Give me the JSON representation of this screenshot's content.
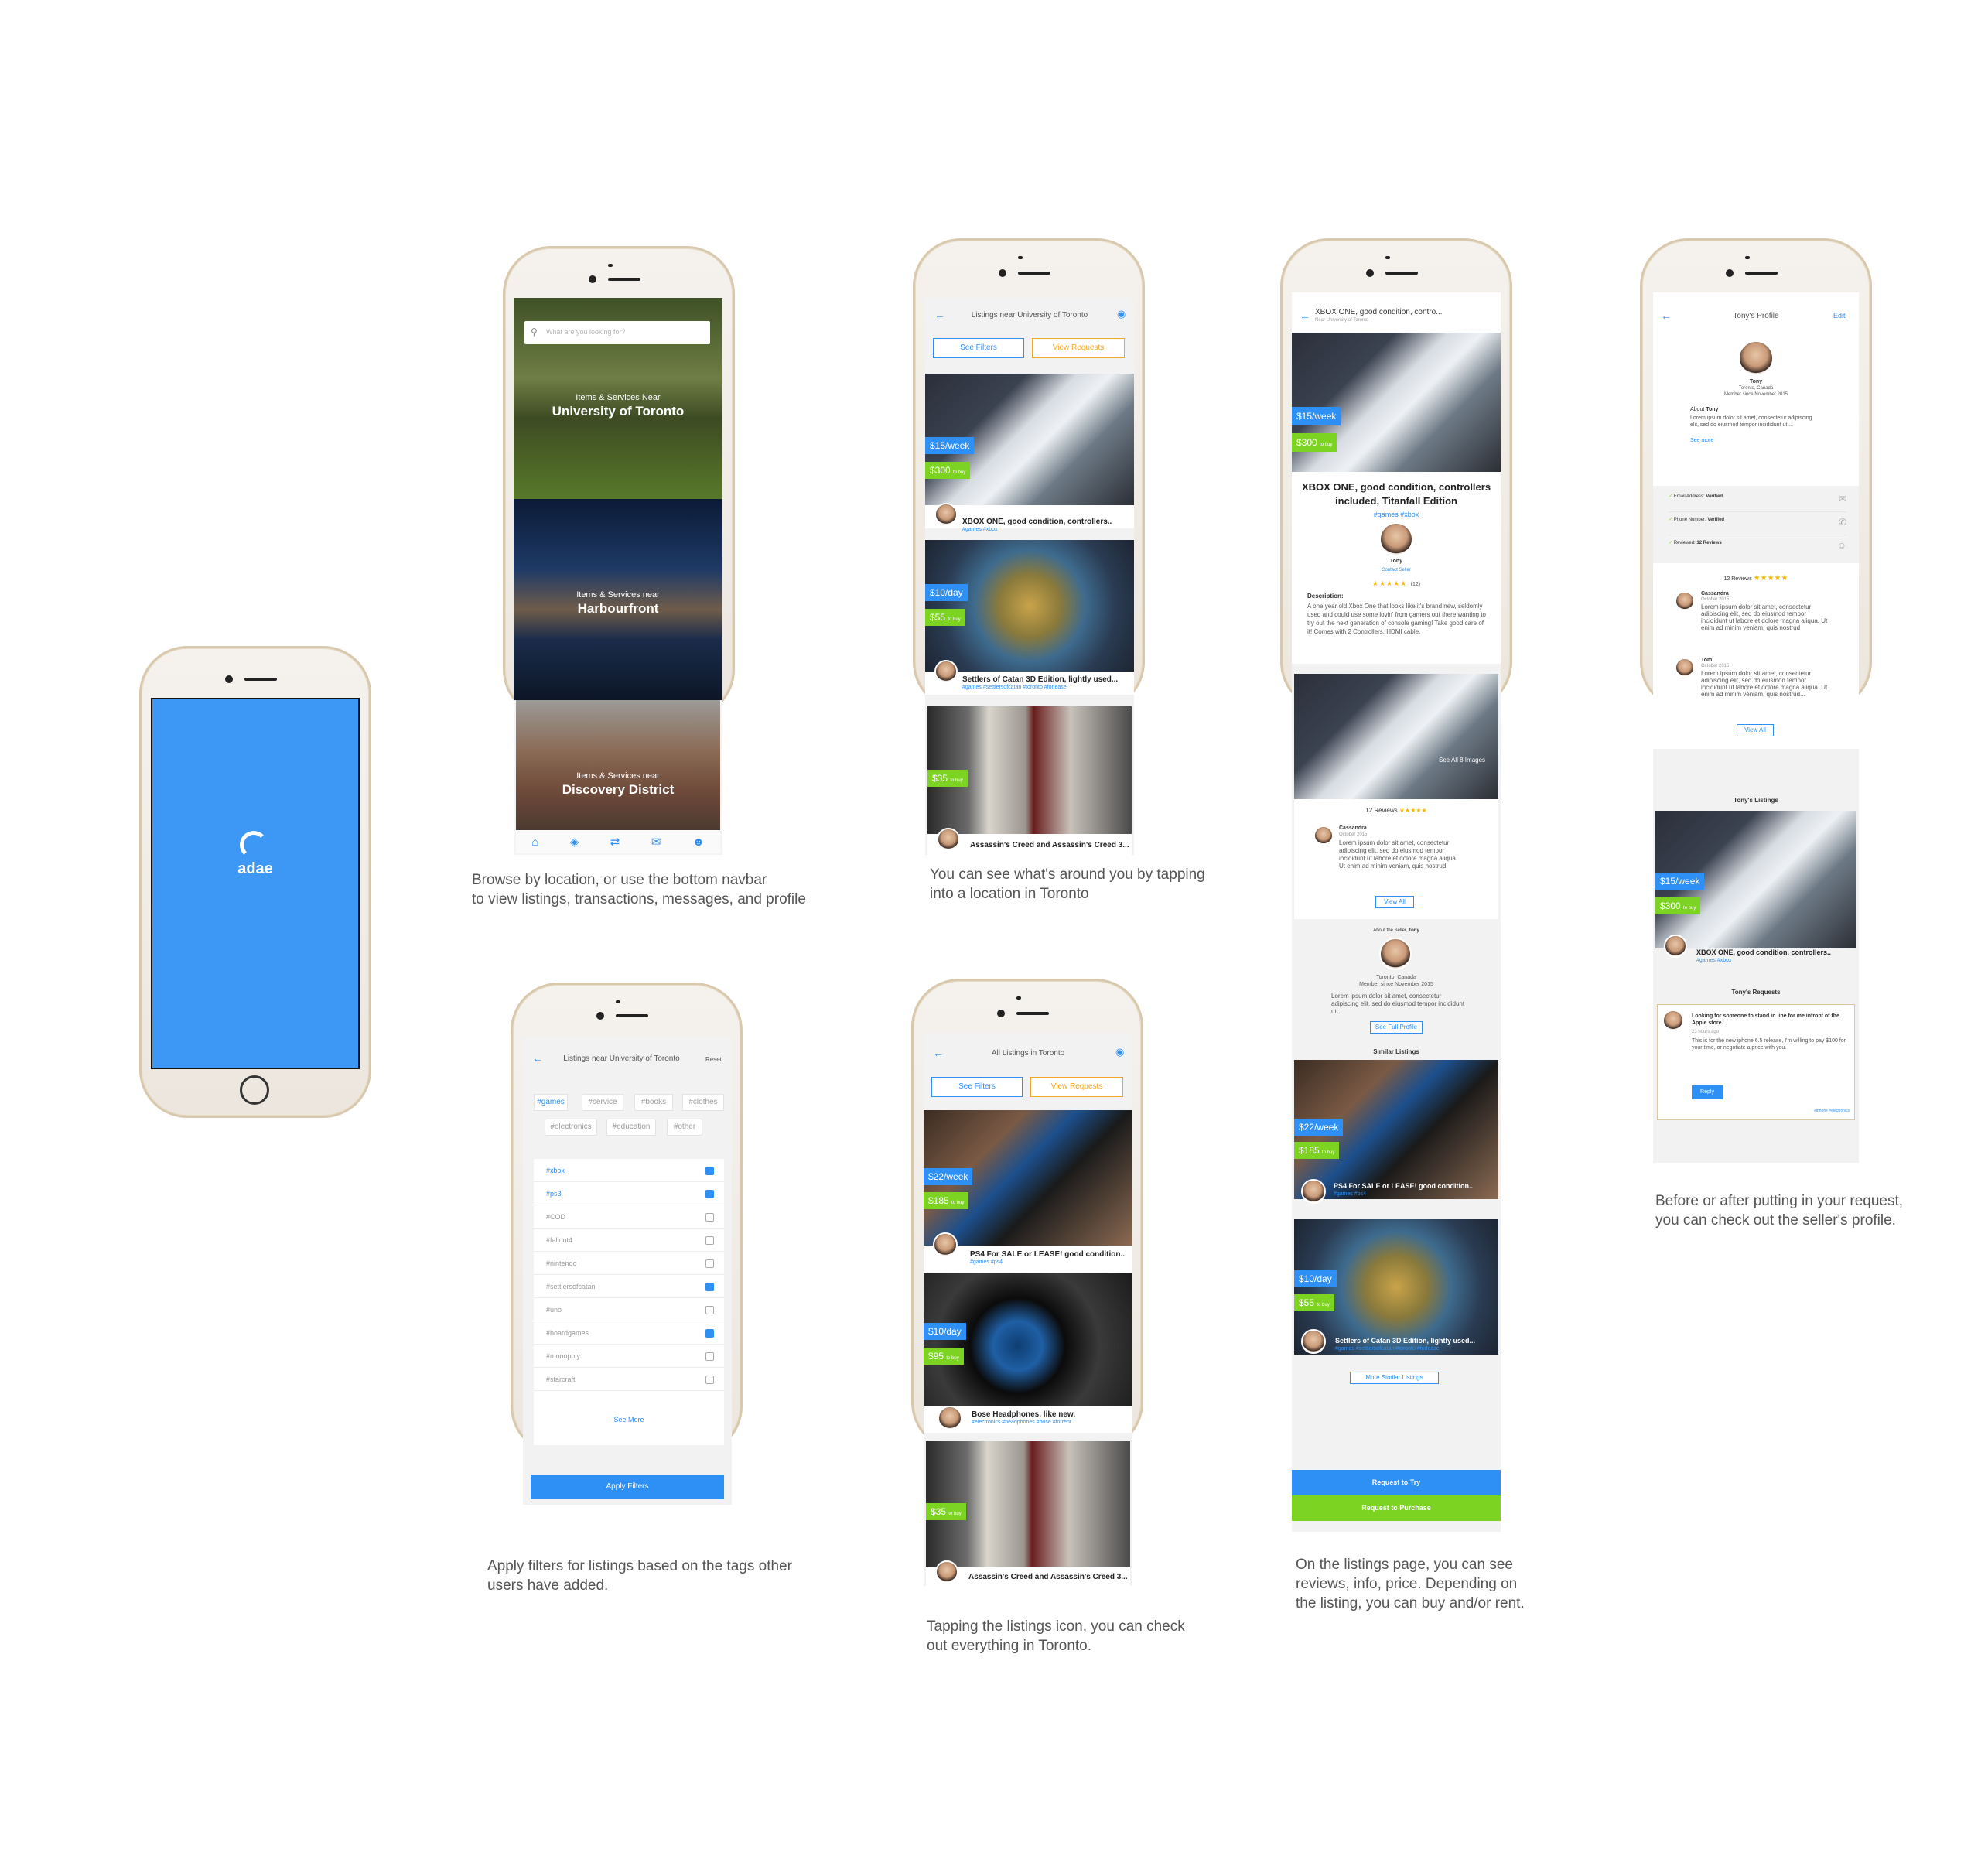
{
  "splash": {
    "logo": "adae"
  },
  "browse": {
    "search_placeholder": "What are you looking for?",
    "locations": [
      {
        "prefix": "Items & Services Near",
        "name": "University of Toronto"
      },
      {
        "prefix": "Items & Services near",
        "name": "Harbourfront"
      },
      {
        "prefix": "Items & Services near",
        "name": "Discovery District"
      }
    ],
    "nav_icons": [
      "home-icon",
      "tag-icon",
      "handshake-icon",
      "mail-icon",
      "profile-icon"
    ],
    "caption": [
      "Browse by location, or use the bottom navbar",
      "to view listings, transactions, messages, and profile"
    ]
  },
  "listings_uoft": {
    "header": "Listings near University of Toronto",
    "see_filters": "See Filters",
    "view_requests": "View Requests",
    "items": [
      {
        "rent": "$15/week",
        "buy": "$300",
        "buy_suffix": "to buy",
        "title": "XBOX ONE, good condition, controllers..",
        "tags": "#games #xbox"
      },
      {
        "rent": "$10/day",
        "buy": "$55",
        "buy_suffix": "to buy",
        "title": "Settlers of Catan 3D Edition, lightly used...",
        "tags": "#games #settlersofcatan #toronto #forlease"
      },
      {
        "buy": "$35",
        "buy_suffix": "to buy",
        "title": "Assassin's Creed and Assassin's Creed 3..."
      }
    ],
    "caption": [
      "You can see what's around you by tapping",
      "into a location in Toronto"
    ]
  },
  "filters": {
    "header": "Listings near University of Toronto",
    "reset": "Reset",
    "tags": [
      "#games",
      "#service",
      "#books",
      "#clothes",
      "#electronics",
      "#education",
      "#other"
    ],
    "options": [
      {
        "label": "#xbox",
        "checked": true
      },
      {
        "label": "#ps3",
        "checked": true
      },
      {
        "label": "#COD",
        "checked": false
      },
      {
        "label": "#fallout4",
        "checked": false
      },
      {
        "label": "#nintendo",
        "checked": false
      },
      {
        "label": "#settlersofcatan",
        "checked": true
      },
      {
        "label": "#uno",
        "checked": false
      },
      {
        "label": "#boardgames",
        "checked": true
      },
      {
        "label": "#monopoly",
        "checked": false
      },
      {
        "label": "#starcraft",
        "checked": false
      }
    ],
    "see_more": "See More",
    "apply": "Apply Filters",
    "caption": [
      "Apply filters for listings based on the tags other",
      "users have added."
    ]
  },
  "all_toronto": {
    "header": "All Listings in Toronto",
    "see_filters": "See Filters",
    "view_requests": "View Requests",
    "items": [
      {
        "rent": "$22/week",
        "buy": "$185",
        "buy_suffix": "to buy",
        "title": "PS4 For SALE or LEASE! good condition..",
        "tags": "#games #ps4"
      },
      {
        "rent": "$10/day",
        "buy": "$95",
        "buy_suffix": "to buy",
        "title": "Bose Headphones, like new.",
        "tags": "#electronics #headphones #bose #forrent"
      },
      {
        "buy": "$35",
        "buy_suffix": "to buy",
        "title": "Assassin's Creed and Assassin's Creed 3..."
      }
    ],
    "caption": [
      "Tapping  the listings icon, you can check",
      "out everything in Toronto."
    ]
  },
  "detail": {
    "header": "XBOX ONE, good condition, contro...",
    "subheader": "Near University of Toronto",
    "rent": "$15/week",
    "buy": "$300",
    "buy_suffix": "to buy",
    "title": [
      "XBOX ONE, good condition, controllers",
      "included, Titanfall Edition"
    ],
    "tags": "#games #xbox",
    "seller": "Tony",
    "contact": "Contact Seller",
    "rating_count": "(12)",
    "desc_label": "Description:",
    "desc": "A one year old Xbox One that looks like it's brand new, seldomly used and could use some lovin' from gamers out there wanting to try out the next generation of console gaming! Take good care of it! Comes with 2 Controllers, HDMI cable.",
    "see_all_images": "See All 8 Images",
    "reviews_title": "12 Reviews",
    "reviewer": "Cassandra",
    "review_date": "October 2015",
    "review_text": "Lorem ipsum dolor sit amet, consectetur adipiscing elit, sed do eiusmod tempor incididunt ut labore et dolore magna aliqua. Ut enim ad minim veniam, quis nostrud",
    "view_all": "View All",
    "about_label": "About the Seller,",
    "about_name": "Tony",
    "seller_loc": "Toronto, Canada",
    "seller_since": "Member since November 2015",
    "seller_text": "Lorem ipsum dolor sit amet, consectetur adipiscing elit, sed do eiusmod tempor incididunt ut ...",
    "full_profile": "See Full Profile",
    "similar": "Similar Listings",
    "sim_items": [
      {
        "rent": "$22/week",
        "buy": "$185",
        "buy_suffix": "to buy",
        "title": "PS4 For SALE or LEASE! good condition..",
        "tags": "#games #ps4"
      },
      {
        "rent": "$10/day",
        "buy": "$55",
        "buy_suffix": "to buy",
        "title": "Settlers of Catan 3D Edition, lightly used...",
        "tags": "#games #settlersofcatan #toronto #forlease"
      }
    ],
    "more_similar": "More Similar Listings",
    "request_try": "Request to Try",
    "request_purchase": "Request to Purchase",
    "caption": [
      "On the listings page, you can see",
      "reviews, info, price. Depending on",
      "the listing, you can buy and/or rent."
    ]
  },
  "profile": {
    "header": "Tony's Profile",
    "edit": "Edit",
    "name": "Tony",
    "loc": "Toronto, Canada",
    "since": "Member since November 2015",
    "about_label": "About",
    "about_name": "Tony",
    "about_text": "Lorem ipsum dolor sit amet, consectetur adipiscing elit, sed do eiusmod tempor incididunt ut ...",
    "see_more": "See more",
    "verifs": [
      {
        "label": "Email Address:",
        "value": "Verified"
      },
      {
        "label": "Phone Number:",
        "value": "Verified"
      },
      {
        "label": "Reviewed:",
        "value": "12 Reviews"
      }
    ],
    "reviews_title": "12 Reviews",
    "reviews": [
      {
        "name": "Cassandra",
        "date": "October 2015",
        "text": "Lorem ipsum dolor sit amet, consectetur adipiscing elit, sed do eiusmod tempor incididunt ut labore et dolore magna aliqua. Ut enim ad minim veniam, quis nostrud"
      },
      {
        "name": "Tom",
        "date": "October 2015",
        "text": "Lorem ipsum dolor sit amet, consectetur adipiscing elit, sed do eiusmod tempor incididunt ut labore et dolore magna aliqua. Ut enim ad minim veniam, quis nostrud..."
      }
    ],
    "view_all": "View All",
    "listings_title": "Tony's Listings",
    "listing": {
      "rent": "$15/week",
      "buy": "$300",
      "buy_suffix": "to buy",
      "title": "XBOX ONE, good condition, controllers..",
      "tags": "#games #xbox"
    },
    "requests_title": "Tony's Requests",
    "request": {
      "title": "Looking for someone to stand in line for me infront of the Apple store.",
      "time": "23 hours ago",
      "text": "This is for the new iphone 6.5 release, I'm willing to pay $100 for your time, or negotiate a price with you.",
      "reply": "Reply",
      "tags": "#iphone #electronics"
    },
    "caption": [
      "Before or after putting in your request,",
      "you can check out the seller's profile."
    ]
  },
  "colors": {
    "blue": "#2e8ff5",
    "green": "#7dd322",
    "splash": "#3d98f5",
    "orange": "#f5a623"
  }
}
